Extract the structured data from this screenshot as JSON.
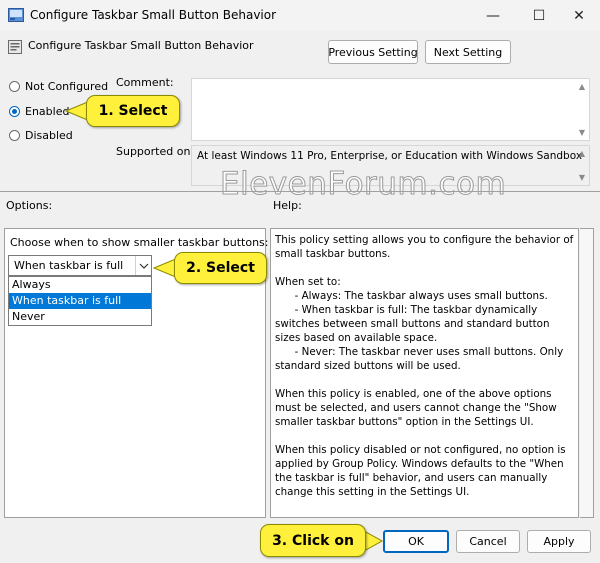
{
  "window": {
    "title": "Configure Taskbar Small Button Behavior",
    "controls": {
      "minimize": "—",
      "maximize": "☐",
      "close": "✕"
    }
  },
  "header": {
    "title": "Configure Taskbar Small Button Behavior",
    "previous_label": "Previous Setting",
    "next_label": "Next Setting"
  },
  "state": {
    "options": [
      {
        "label": "Not Configured",
        "selected": false
      },
      {
        "label": "Enabled",
        "selected": true
      },
      {
        "label": "Disabled",
        "selected": false
      }
    ]
  },
  "comment": {
    "label": "Comment:",
    "value": ""
  },
  "supported": {
    "label": "Supported on:",
    "value": "At least Windows 11 Pro, Enterprise, or Education with Windows Sandbox"
  },
  "watermark": "ElevenForum.com",
  "options_section": {
    "label": "Options:",
    "prompt": "Choose when to show smaller taskbar buttons:",
    "combo_value": "When taskbar is full",
    "dropdown_items": [
      {
        "label": "Always",
        "selected": false
      },
      {
        "label": "When taskbar is full",
        "selected": true
      },
      {
        "label": "Never",
        "selected": false
      }
    ]
  },
  "help_section": {
    "label": "Help:",
    "text": "This policy setting allows you to configure the behavior of small taskbar buttons.\n\nWhen set to:\n      - Always: The taskbar always uses small buttons.\n      - When taskbar is full: The taskbar dynamically switches between small buttons and standard button sizes based on available space.\n      - Never: The taskbar never uses small buttons. Only standard sized buttons will be used.\n\nWhen this policy is enabled, one of the above options must be selected, and users cannot change the \"Show smaller taskbar buttons\" option in the Settings UI.\n\nWhen this policy disabled or not configured, no option is applied by Group Policy. Windows defaults to the \"When the taskbar is full\" behavior, and users can manually change this setting in the Settings UI."
  },
  "footer": {
    "ok_label": "OK",
    "cancel_label": "Cancel",
    "apply_label": "Apply"
  },
  "callouts": {
    "step1": "1. Select",
    "step2": "2. Select",
    "step3": "3. Click on"
  },
  "colors": {
    "accent": "#0067c0",
    "selection": "#0078d7",
    "callout": "#fff03c"
  }
}
